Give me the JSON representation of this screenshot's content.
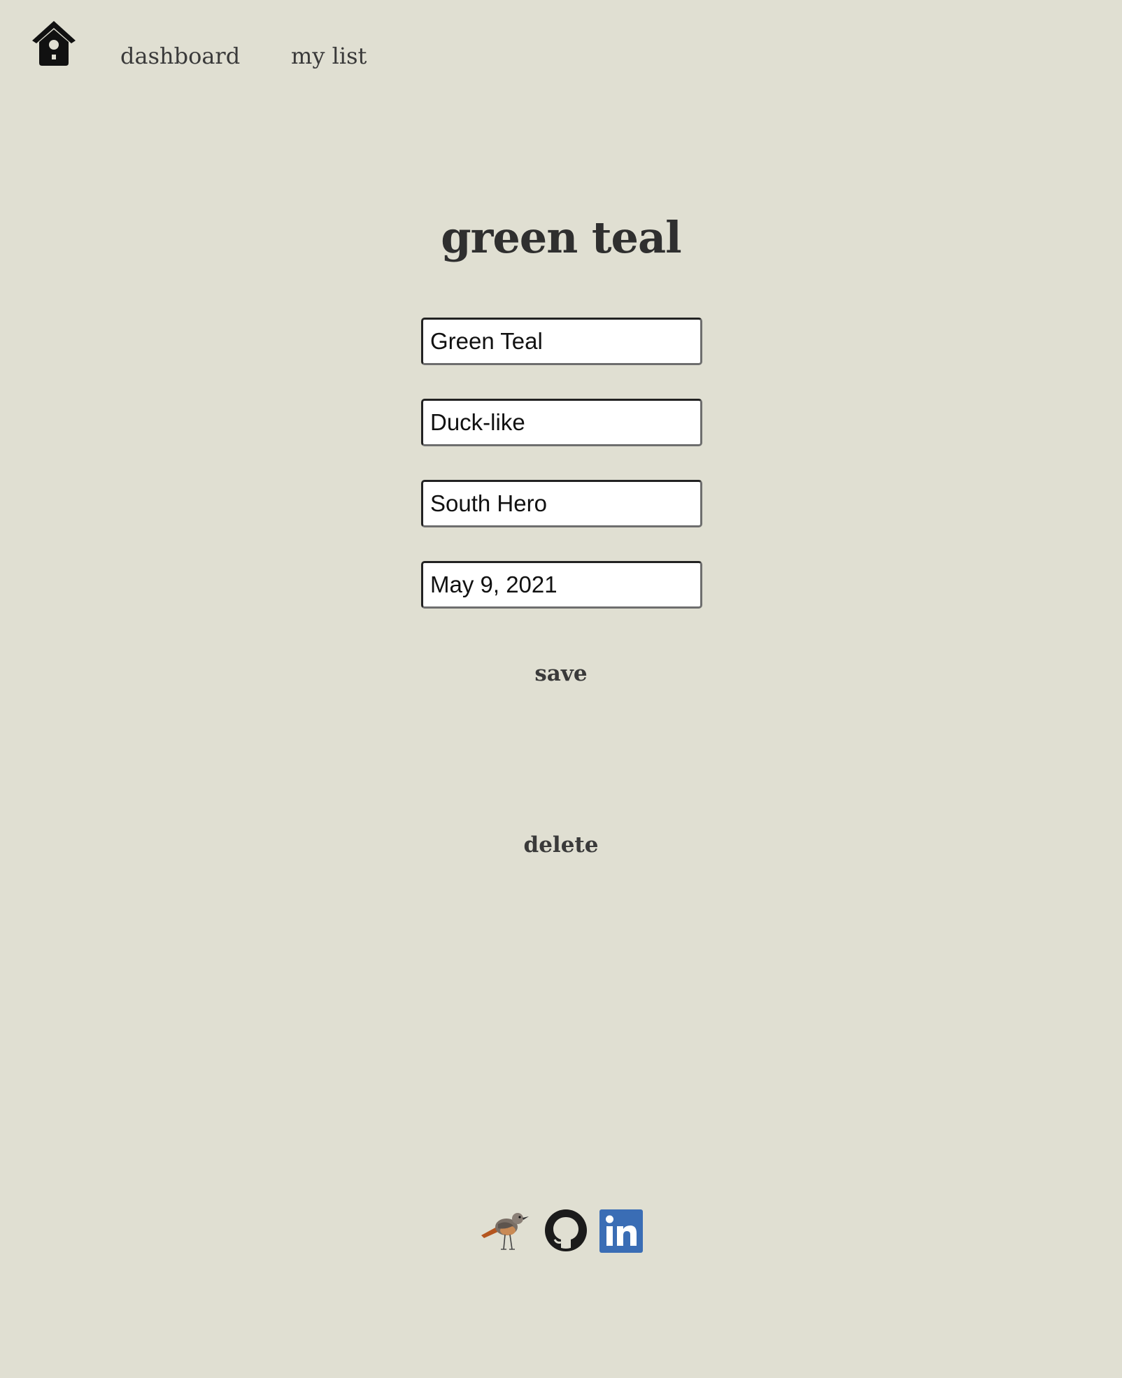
{
  "nav": {
    "home_icon": "birdhouse-icon",
    "links": [
      {
        "label": "dashboard"
      },
      {
        "label": "my list"
      }
    ]
  },
  "page": {
    "title": "green teal"
  },
  "form": {
    "fields": [
      {
        "value": "Green Teal"
      },
      {
        "value": "Duck-like"
      },
      {
        "value": "South Hero"
      },
      {
        "value": "May 9, 2021"
      }
    ],
    "save_label": "save",
    "delete_label": "delete"
  },
  "footer": {
    "icons": [
      "bird-icon",
      "github-icon",
      "linkedin-icon"
    ],
    "linkedin_color": "#3a6db5"
  },
  "colors": {
    "background": "#e0dfd2",
    "text": "#333333"
  }
}
